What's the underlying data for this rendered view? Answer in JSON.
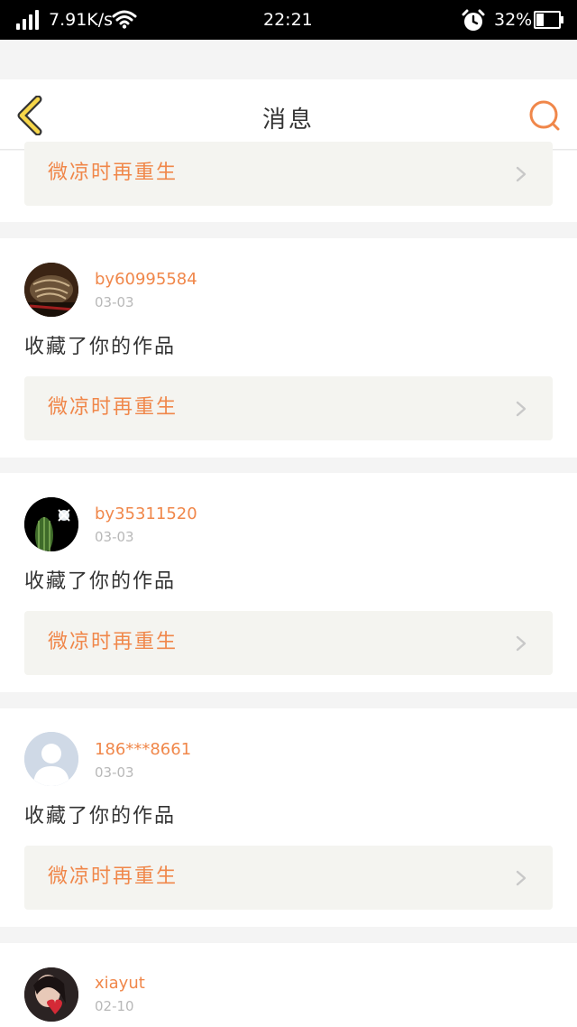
{
  "status_bar": {
    "net_speed": "7.91K/s",
    "time": "22:21",
    "battery_percent": "32%",
    "battery_level": 0.32
  },
  "header": {
    "title": "消息",
    "back_icon": "chevron-left-icon",
    "search_icon": "search-icon"
  },
  "colors": {
    "accent": "#f0874a",
    "back_icon_fill": "#f6d64a",
    "link_box_bg": "#f4f4f0",
    "muted": "#b8b8b8"
  },
  "top_partial_card": {
    "link_label": "微凉时再重生"
  },
  "messages": [
    {
      "username": "by60995584",
      "date": "03-03",
      "text": "收藏了你的作品",
      "link_label": "微凉时再重生"
    },
    {
      "username": "by35311520",
      "date": "03-03",
      "text": "收藏了你的作品",
      "link_label": "微凉时再重生"
    },
    {
      "username": "186***8661",
      "date": "03-03",
      "text": "收藏了你的作品",
      "link_label": "微凉时再重生"
    },
    {
      "username": "xiayut",
      "date": "02-10"
    }
  ]
}
